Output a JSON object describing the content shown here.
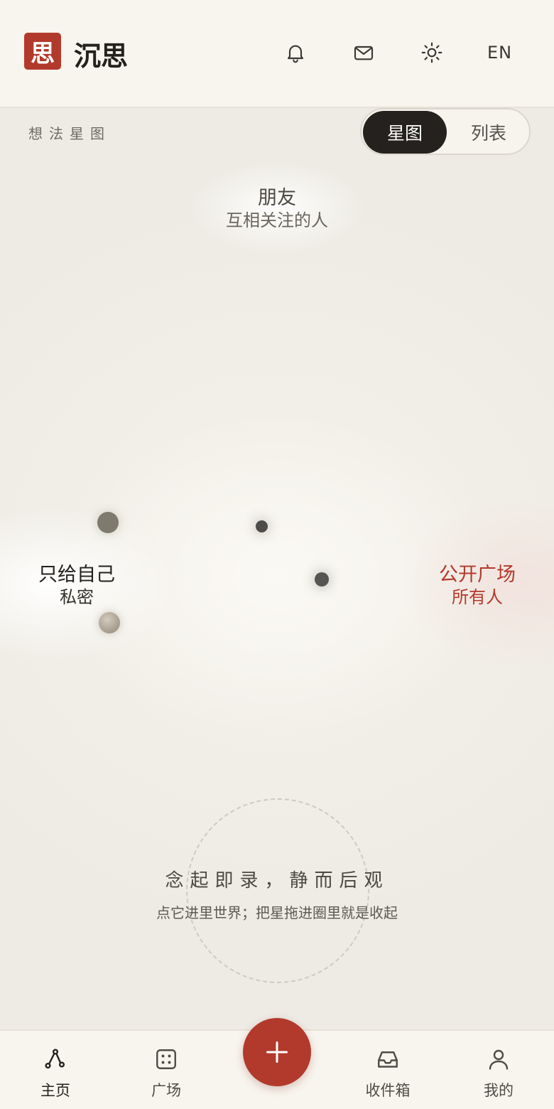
{
  "header": {
    "logo_glyph": "思",
    "app_title": "沉思",
    "icons": [
      "bell-icon",
      "mail-icon",
      "sun-icon"
    ],
    "language_toggle": "EN"
  },
  "canvas": {
    "label": "想法星图",
    "view_toggle": {
      "options": [
        "星图",
        "列表"
      ],
      "selected": "星图"
    },
    "zones": {
      "top": {
        "title": "朋友",
        "subtitle": "互相关注的人"
      },
      "left": {
        "title": "只给自己",
        "subtitle": "私密"
      },
      "right": {
        "title": "公开广场",
        "subtitle": "所有人"
      }
    },
    "drop_zone": {
      "motto": "念起即录，静而后观",
      "hint": "点它进里世界；把星拖进圈里就是收起"
    }
  },
  "bottom_nav": {
    "items": [
      {
        "label": "主页",
        "icon": "graph-icon"
      },
      {
        "label": "广场",
        "icon": "dice-icon"
      },
      {
        "label": "收件箱",
        "icon": "inbox-icon"
      },
      {
        "label": "我的",
        "icon": "user-icon"
      }
    ],
    "active": "主页",
    "fab_icon": "plus-icon"
  },
  "colors": {
    "accent": "#b23a2c",
    "background": "#f4f1ea",
    "toggle_active": "#24211e"
  }
}
